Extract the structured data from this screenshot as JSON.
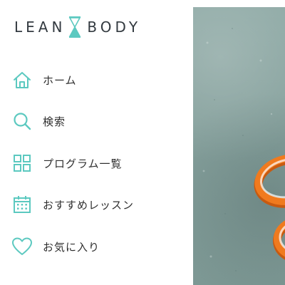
{
  "brand": {
    "left_word": "LEAN",
    "right_word": "BODY",
    "text_color": "#333a40",
    "accent_color": "#5cc9c0"
  },
  "nav": {
    "items": [
      {
        "label": "ホーム",
        "icon": "home-icon"
      },
      {
        "label": "検索",
        "icon": "search-icon"
      },
      {
        "label": "プログラム一覧",
        "icon": "grid-icon"
      },
      {
        "label": "おすすめレッスン",
        "icon": "calendar-icon"
      },
      {
        "label": "お気に入り",
        "icon": "heart-icon"
      }
    ]
  },
  "hero": {
    "image": "concrete-surface-with-orange-rings",
    "background_color": "#86a19d",
    "ring_color": "#f07a1e"
  }
}
